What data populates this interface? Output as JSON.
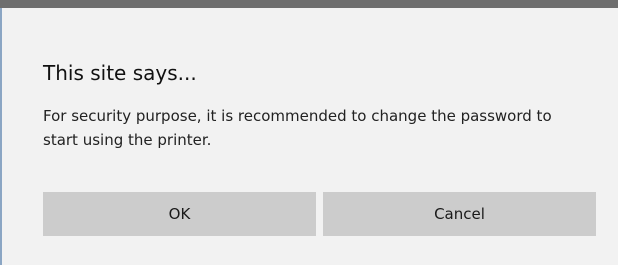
{
  "dialog": {
    "title": "This site says...",
    "message": "For security purpose, it is recommended to change the password to start using the printer.",
    "ok_label": "OK",
    "cancel_label": "Cancel"
  },
  "colors": {
    "background": "#f2f2f2",
    "button": "#cccccc",
    "top_bar": "#6e6e6e"
  }
}
